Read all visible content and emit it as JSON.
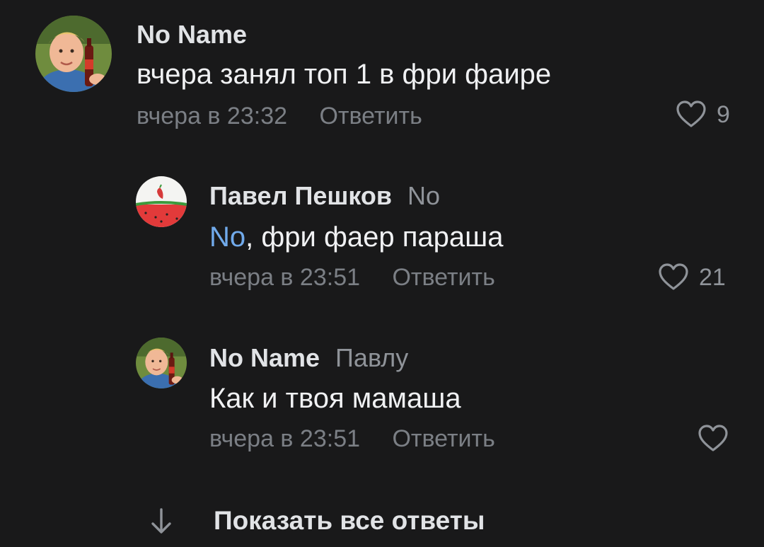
{
  "comments": [
    {
      "author": "No Name",
      "reply_to": "",
      "mention": "",
      "text": "вчера занял топ 1 в фри фаире",
      "time": "вчера в 23:32",
      "reply_label": "Ответить",
      "likes": "9",
      "avatar": "boy-with-bottle"
    },
    {
      "author": "Павел Пешков",
      "reply_to": "No",
      "mention": "No",
      "text": ", фри фаер параша",
      "time": "вчера в 23:51",
      "reply_label": "Ответить",
      "likes": "21",
      "avatar": "watermelon"
    },
    {
      "author": "No Name",
      "reply_to": "Павлу",
      "mention": "",
      "text": "Как и твоя мамаша",
      "time": "вчера в 23:51",
      "reply_label": "Ответить",
      "likes": "",
      "avatar": "boy-with-bottle"
    }
  ],
  "show_all_replies": {
    "label": "Показать все ответы",
    "icon": "arrow-down-icon"
  },
  "colors": {
    "background": "#19191a",
    "text_primary": "#e1e3e6",
    "text_secondary": "#7b7f85",
    "mention": "#71aaeb"
  }
}
